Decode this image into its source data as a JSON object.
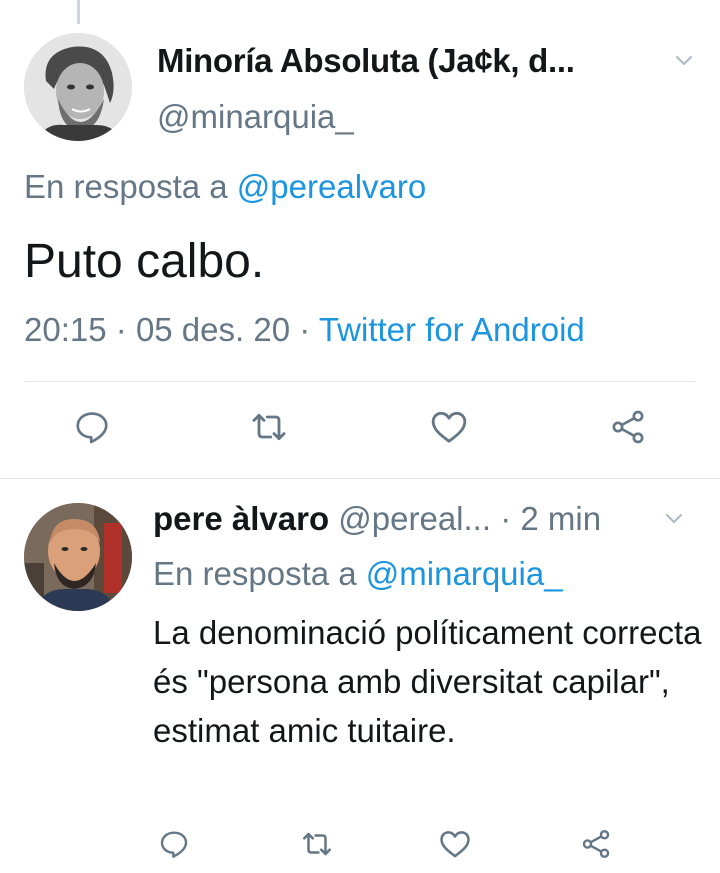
{
  "main_tweet": {
    "display_name": "Minoría Absoluta (Ja¢k, d...",
    "handle": "@minarquia_",
    "reply_prefix": "En resposta a",
    "reply_to": "@perealvaro",
    "text": "Puto calbo.",
    "time": "20:15",
    "date": "05 des. 20",
    "separator": "·",
    "source": "Twitter for Android"
  },
  "reply_tweet": {
    "display_name": "pere àlvaro",
    "handle": "@pereal...",
    "separator": "·",
    "relative_time": "2 min",
    "reply_prefix": "En resposta a",
    "reply_to": "@minarquia_",
    "text": "La denominació políticament correcta és \"persona amb diversitat capilar\", estimat amic tuitaire."
  },
  "colors": {
    "text_primary": "#14171a",
    "text_secondary": "#657786",
    "link": "#1b95e0",
    "divider": "#e1e8ed"
  },
  "icons": [
    "chevron-down-icon",
    "reply-icon",
    "retweet-icon",
    "like-icon",
    "share-icon"
  ]
}
